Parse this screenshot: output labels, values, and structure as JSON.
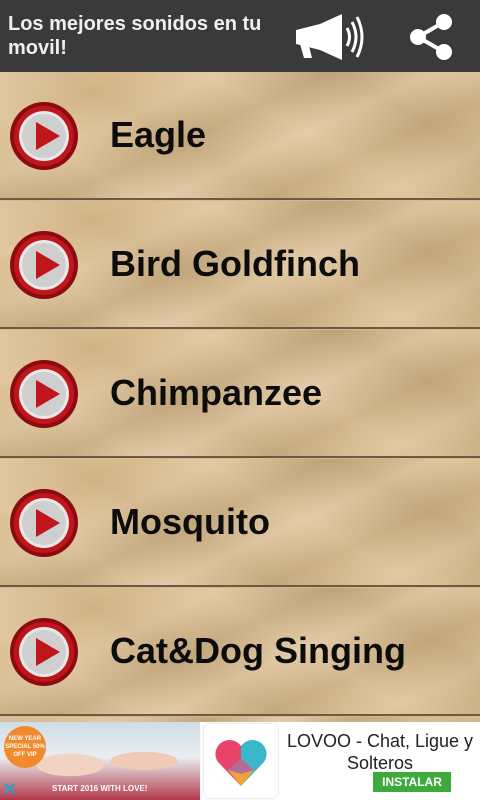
{
  "header": {
    "title": "Los mejores sonidos en tu movil!",
    "megaphone_icon": "megaphone-icon",
    "share_icon": "share-icon"
  },
  "sounds": [
    {
      "label": "Eagle"
    },
    {
      "label": "Bird Goldfinch"
    },
    {
      "label": "Chimpanzee"
    },
    {
      "label": "Mosquito"
    },
    {
      "label": "Cat&Dog Singing"
    }
  ],
  "ad": {
    "badge": "NEW YEAR SPECIAL 50% OFF VIP",
    "tagline": "START 2016 WITH LOVE!",
    "app_name": "LOVOO - Chat, Ligue y Solteros",
    "install_label": "INSTALAR",
    "close_icon": "close-icon"
  },
  "colors": {
    "header_bg": "#3a3a3a",
    "row_bg": "#dcbc8c",
    "play_red": "#c0151a",
    "install_green": "#3eaa3b"
  }
}
